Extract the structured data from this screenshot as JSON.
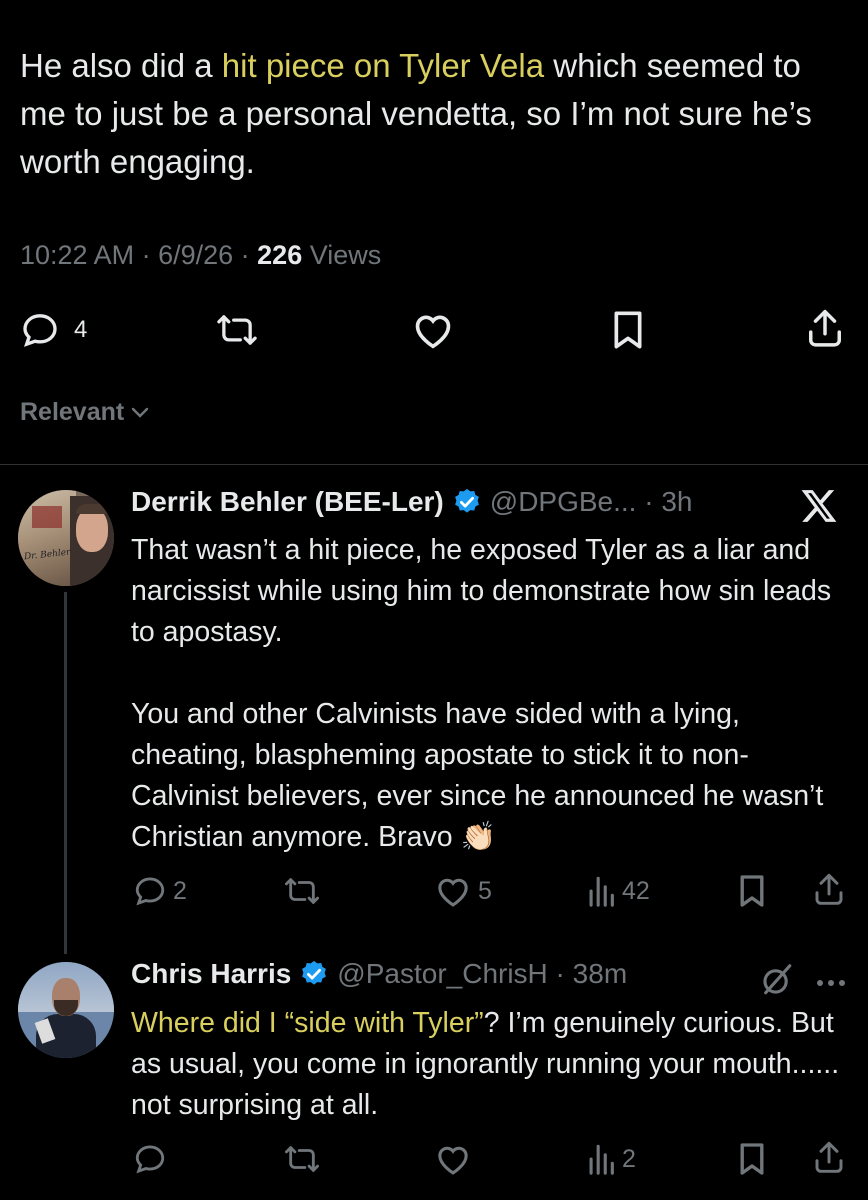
{
  "main_tweet": {
    "text_before": "He also did a ",
    "text_highlight": "hit piece on Tyler Vela",
    "text_after": " which seemed to me to just be a personal vendetta, so I’m not sure he’s worth engaging.",
    "time": "10:22 AM",
    "date": "6/9/26",
    "views_count": "226",
    "views_label": "Views",
    "reply_count": "4"
  },
  "sort": {
    "label": "Relevant"
  },
  "replies": [
    {
      "name": "Derrik Behler (BEE-Ler)",
      "handle": "@DPGBe...",
      "time": "3h",
      "avatar_caption": "Dr. Behler",
      "text": "That wasn’t a hit piece, he exposed Tyler as a liar and narcissist while using him to demonstrate how sin leads to apostasy.\n\nYou and other Calvinists have sided with a lying, cheating, blaspheming apostate to stick it to non-Calvinist believers, ever since he announced he wasn’t Christian anymore. Bravo",
      "emoji": "👏🏻",
      "reply_count": "2",
      "like_count": "5",
      "view_count": "42"
    },
    {
      "name": "Chris Harris",
      "handle": "@Pastor_ChrisH",
      "time": "38m",
      "text_highlight": "Where did I “side with Tyler”",
      "text_rest": "? I’m genuinely curious. But as usual, you come in ignorantly running your mouth...... not surprising at all.",
      "view_count": "2"
    }
  ],
  "icons": [
    "reply-icon",
    "retweet-icon",
    "like-icon",
    "bookmark-icon",
    "share-icon",
    "views-icon",
    "verified-icon",
    "x-logo-icon",
    "grok-icon",
    "more-icon",
    "chevron-down-icon"
  ],
  "colors": {
    "background": "#000000",
    "text": "#e7e9ea",
    "muted": "#71767b",
    "highlight": "#d9cf5e",
    "verified": "#1d9bf0"
  }
}
